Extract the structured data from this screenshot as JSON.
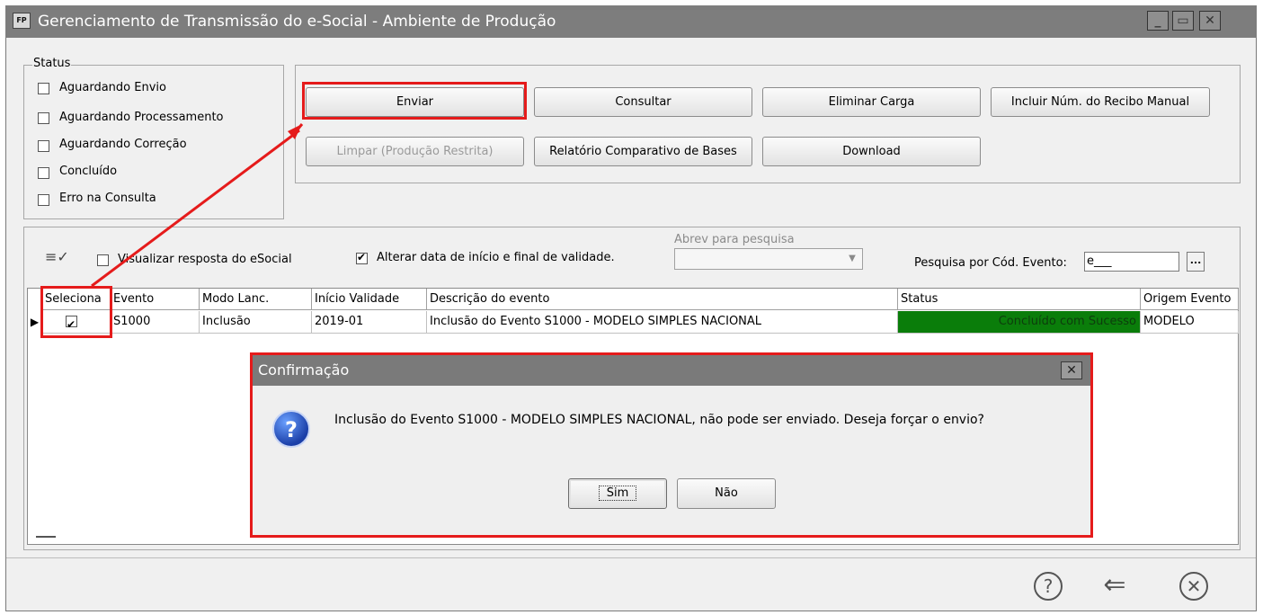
{
  "window": {
    "app_icon": "FP",
    "title": "Gerenciamento de Transmissão do e-Social - Ambiente de Produção",
    "controls": [
      "minimize-icon",
      "maximize-icon",
      "close-icon"
    ]
  },
  "status_group": {
    "legend": "Status",
    "items": [
      {
        "label": "Aguardando Envio",
        "checked": false
      },
      {
        "label": "Aguardando Processamento",
        "checked": false
      },
      {
        "label": "Aguardando Correção",
        "checked": false
      },
      {
        "label": "Concluído",
        "checked": false
      },
      {
        "label": "Erro na Consulta",
        "checked": false
      }
    ]
  },
  "actions": {
    "enviar": "Enviar",
    "consultar": "Consultar",
    "eliminar_carga": "Eliminar Carga",
    "incluir_recibo": "Incluir Núm. do Recibo Manual",
    "limpar": "Limpar (Produção Restrita)",
    "relatorio": "Relatório Comparativo de Bases",
    "download": "Download"
  },
  "filters": {
    "visualizar_resposta": {
      "label": "Visualizar resposta do eSocial",
      "checked": false
    },
    "alterar_data": {
      "label": "Alterar data de início e final de validade.",
      "checked": true
    },
    "abrev_label": "Abrev para pesquisa",
    "abrev_value": "",
    "pesquisa_label": "Pesquisa por Cód. Evento:",
    "pesquisa_value": "e___",
    "ellipsis": "..."
  },
  "grid": {
    "columns": [
      "Seleciona",
      "Evento",
      "Modo Lanc.",
      "Início Validade",
      "Descrição do evento",
      "Status",
      "Origem Evento"
    ],
    "rows": [
      {
        "selected": true,
        "evento": "S1000",
        "modo": "Inclusão",
        "inicio": "2019-01",
        "descricao": "Inclusão do Evento S1000 - MODELO SIMPLES NACIONAL",
        "status": "Concluído com Sucesso",
        "origem": "MODELO"
      }
    ],
    "status_color": "#0a7d0a"
  },
  "dialog": {
    "title": "Confirmação",
    "message": "Inclusão do Evento S1000 - MODELO SIMPLES NACIONAL, não pode ser enviado. Deseja forçar o envio?",
    "yes": "Sim",
    "no": "Não",
    "icon": "question-icon"
  },
  "bottom": {
    "icons": [
      "help-icon",
      "back-arrow-icon",
      "close-circle-icon"
    ]
  },
  "colors": {
    "highlight": "#e51b1b",
    "titlebar": "#7d7d7d"
  }
}
